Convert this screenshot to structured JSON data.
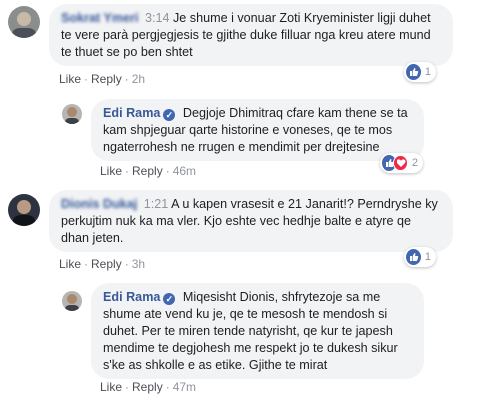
{
  "comments": [
    {
      "author": "Sokrat Ymeri",
      "time": "3:14",
      "text": "Je shume i vonuar Zoti Kryeminister ligji duhet te vere parà pergjegjesis te gjithe duke filluar nga kreu atere mund te thuet se po ben shtet",
      "like": "Like",
      "reply": "Reply",
      "age": "2h",
      "reactions": {
        "count": "1"
      }
    },
    {
      "author": "Edi Rama",
      "text": "Degjoje Dhimitraq cfare kam thene se ta kam shpjeguar qarte historine e voneses, qe te mos ngaterrohesh ne rrugen e mendimit per drejtesine",
      "like": "Like",
      "reply": "Reply",
      "age": "46m",
      "reactions": {
        "count": "2"
      }
    },
    {
      "author": "Dionis Dukaj",
      "time": "1:21",
      "text": "A u kapen vrasesit e 21 Janarit!? Perndryshe ky perkujtim nuk ka ma vler. Kjo eshte vec hedhje balte e atyre qe dhan jeten.",
      "like": "Like",
      "reply": "Reply",
      "age": "3h",
      "reactions": {
        "count": "1"
      }
    },
    {
      "author": "Edi Rama",
      "text": "Miqesisht Dionis, shfrytezoje sa me shume ate vend ku je, qe te mesosh te mendosh si duhet. Per te miren tende natyrisht, qe kur te japesh mendime te degjohesh me respekt jo te dukesh sikur s'ke as shkolle e as etike. Gjithe te mirat",
      "like": "Like",
      "reply": "Reply",
      "age": "47m"
    }
  ],
  "colors": {
    "link": "#385898",
    "bubble": "#f2f3f5",
    "like": "#4267b2",
    "love": "#f0284a"
  }
}
